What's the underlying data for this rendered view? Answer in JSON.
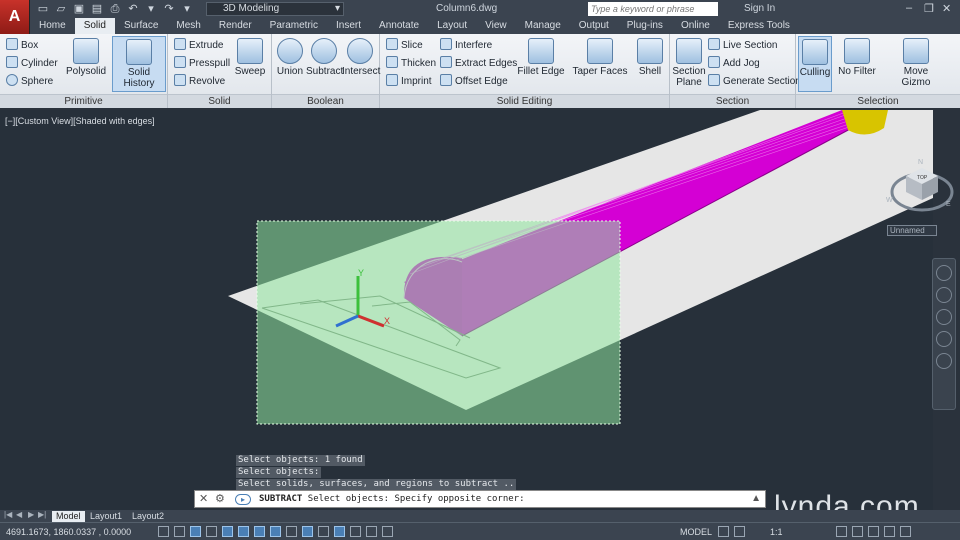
{
  "app": {
    "logo": "A",
    "workspace": "3D Modeling",
    "document_title": "Column6.dwg",
    "search_placeholder": "Type a keyword or phrase",
    "sign_in": "Sign In"
  },
  "tabs": [
    "Home",
    "Solid",
    "Surface",
    "Mesh",
    "Render",
    "Parametric",
    "Insert",
    "Annotate",
    "Layout",
    "View",
    "Manage",
    "Output",
    "Plug-ins",
    "Online",
    "Express Tools"
  ],
  "active_tab": "Solid",
  "ribbon": {
    "primitive": {
      "label": "Primitive",
      "box": "Box",
      "cylinder": "Cylinder",
      "sphere": "Sphere",
      "polysolid": "Polysolid",
      "solid_history": "Solid History"
    },
    "solid": {
      "label": "Solid",
      "extrude": "Extrude",
      "presspull": "Presspull",
      "revolve": "Revolve",
      "sweep": "Sweep"
    },
    "boolean": {
      "label": "Boolean",
      "union": "Union",
      "subtract": "Subtract",
      "intersect": "Intersect"
    },
    "solid_editing": {
      "label": "Solid Editing",
      "slice": "Slice",
      "thicken": "Thicken",
      "imprint": "Imprint",
      "interfere": "Interfere",
      "extract_edges": "Extract Edges",
      "offset_edge": "Offset Edge",
      "fillet_edge": "Fillet Edge",
      "taper_faces": "Taper Faces",
      "shell": "Shell"
    },
    "section": {
      "label": "Section",
      "section_plane": "Section Plane",
      "live_section": "Live Section",
      "add_jog": "Add Jog",
      "generate_section": "Generate Section"
    },
    "selection": {
      "label": "Selection",
      "culling": "Culling",
      "no_filter": "No Filter",
      "move_gizmo": "Move Gizmo"
    }
  },
  "viewport": {
    "label": "[−][Custom View][Shaded with edges]",
    "named_view": "Unnamed",
    "viewcube_face": "TOP",
    "compass": {
      "n": "N",
      "w": "W",
      "e": "E"
    },
    "selection_color": "#8fe59f",
    "column_color": "#d400d4"
  },
  "command": {
    "history": [
      "Select objects: 1 found",
      "Select objects:",
      "Select solids, surfaces, and regions to subtract .."
    ],
    "current_command": "SUBTRACT",
    "current_prompt": "Select objects: Specify opposite corner:"
  },
  "layouts": [
    "Model",
    "Layout1",
    "Layout2"
  ],
  "status": {
    "coordinates": "4691.1673, 1860.0337 , 0.0000",
    "model": "MODEL",
    "scale": "1:1"
  },
  "watermark": "lynda.com"
}
